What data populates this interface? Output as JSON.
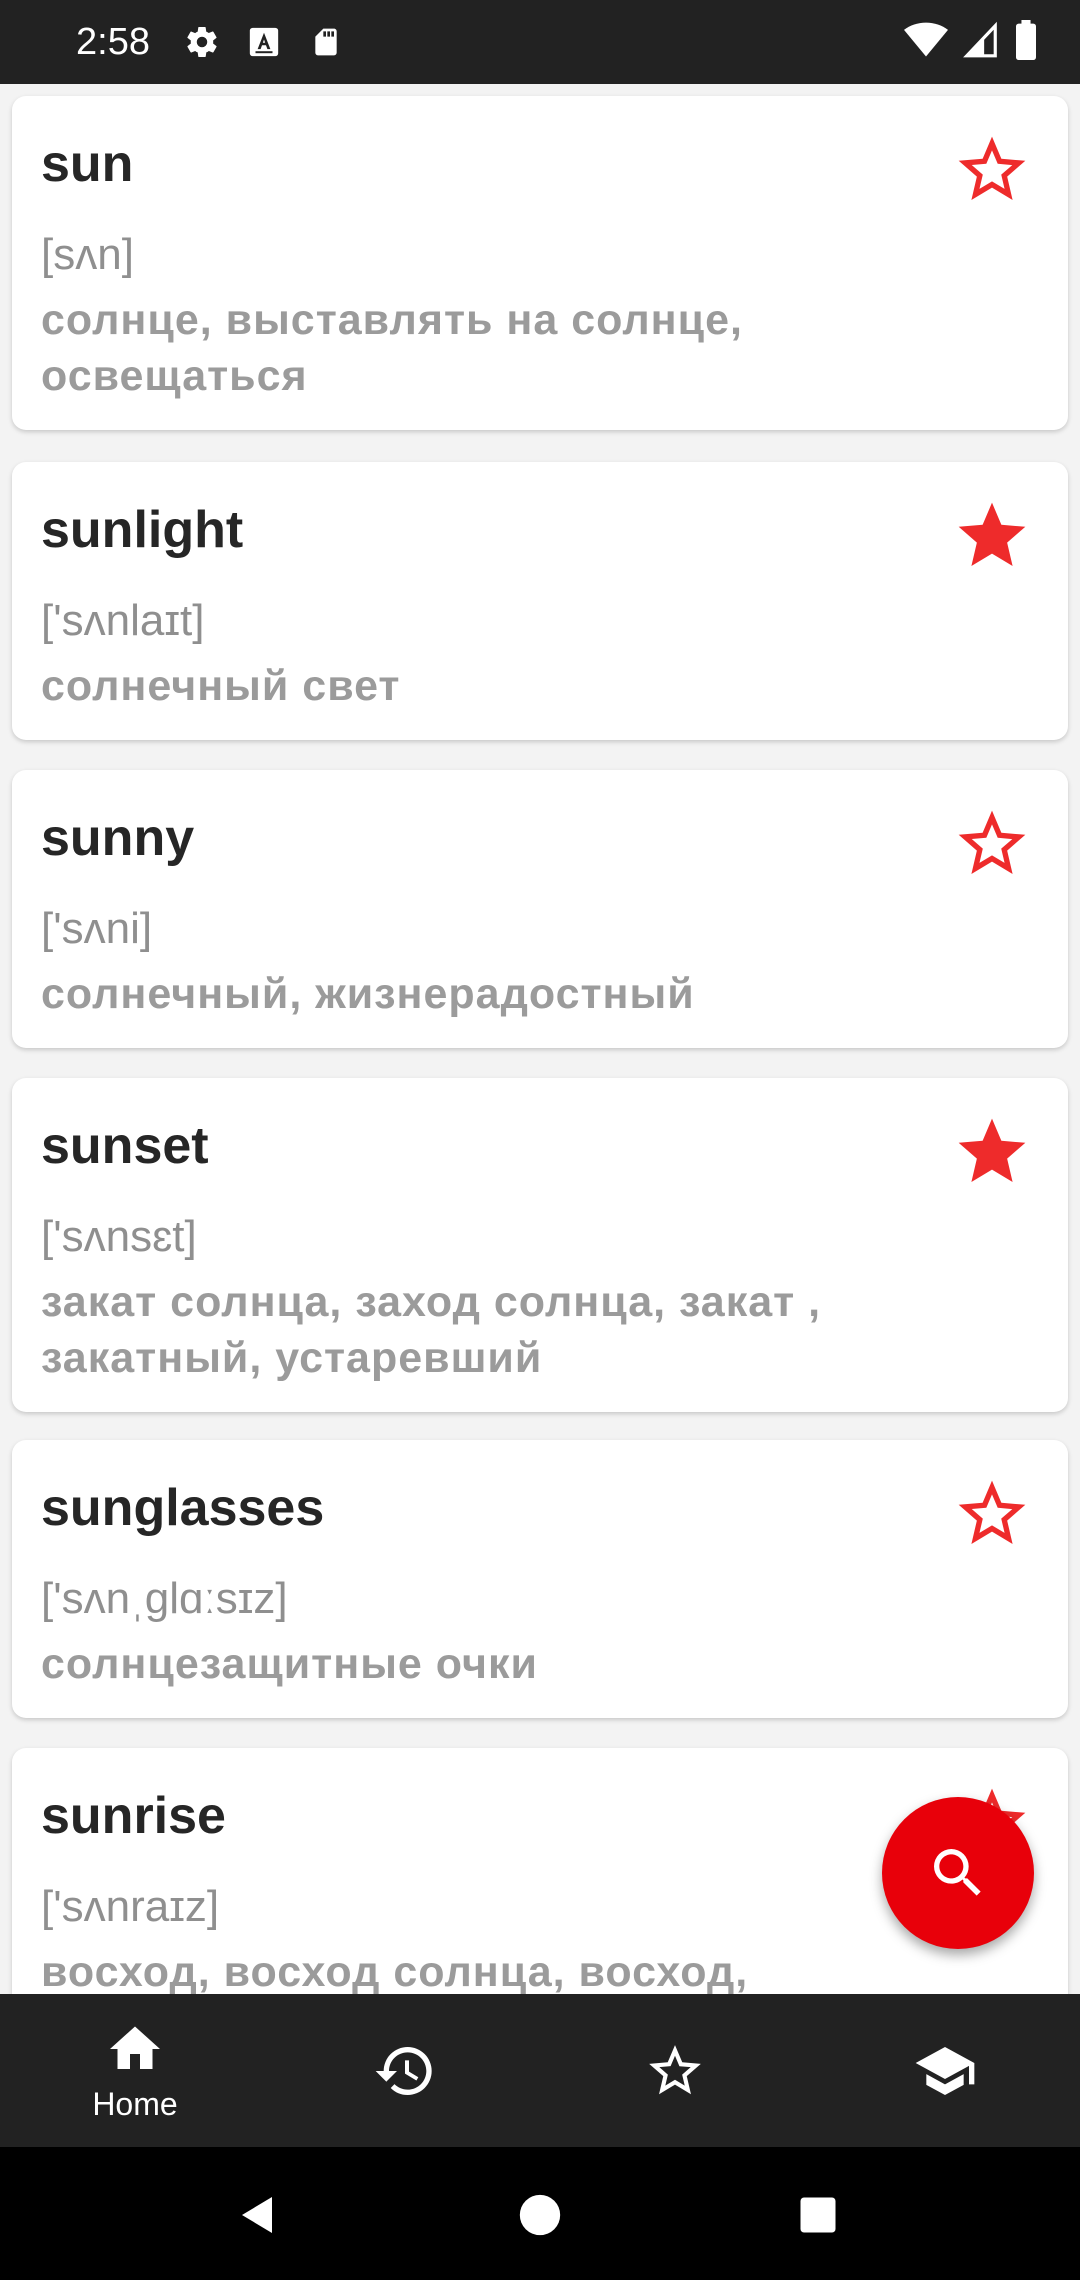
{
  "status_bar": {
    "time": "2:58",
    "left_icons": [
      "gear-icon",
      "font-download-icon",
      "sd-card-icon"
    ],
    "right_icons": [
      "wifi-icon",
      "cellular-signal-icon",
      "battery-icon"
    ]
  },
  "colors": {
    "accent": "#e8000a",
    "star": "#ee2b2b",
    "bar": "#222222",
    "word": "#262626",
    "secondary": "#9b9b9b"
  },
  "entries": [
    {
      "word": "sun",
      "transcription": "[sʌn]",
      "translation": "солнце, выставлять на солнце, освещаться",
      "favorite": false
    },
    {
      "word": "sunlight",
      "transcription": "['sʌnlaɪt]",
      "translation": "солнечный свет",
      "favorite": true
    },
    {
      "word": "sunny",
      "transcription": "['sʌni]",
      "translation": "солнечный, жизнерадостный",
      "favorite": false
    },
    {
      "word": "sunset",
      "transcription": "['sʌnsɛt]",
      "translation": "закат солнца, заход солнца, закат , закатный, устаревший",
      "favorite": true
    },
    {
      "word": "sunglasses",
      "transcription": "['sʌnˌglɑːsɪz]",
      "translation": "солнцезащитные очки",
      "favorite": false
    },
    {
      "word": "sunrise",
      "transcription": "['sʌnraɪz]",
      "translation": "восход, восход солнца, восход,",
      "favorite": false
    }
  ],
  "fab": {
    "icon": "search-icon"
  },
  "bottom_nav": {
    "items": [
      {
        "icon": "home-icon",
        "label": "Home",
        "active": true
      },
      {
        "icon": "history-icon",
        "label": "",
        "active": false
      },
      {
        "icon": "star-outline-icon",
        "label": "",
        "active": false
      },
      {
        "icon": "school-icon",
        "label": "",
        "active": false
      }
    ]
  },
  "system_nav": [
    "back-icon",
    "home-circle-icon",
    "recents-icon"
  ]
}
